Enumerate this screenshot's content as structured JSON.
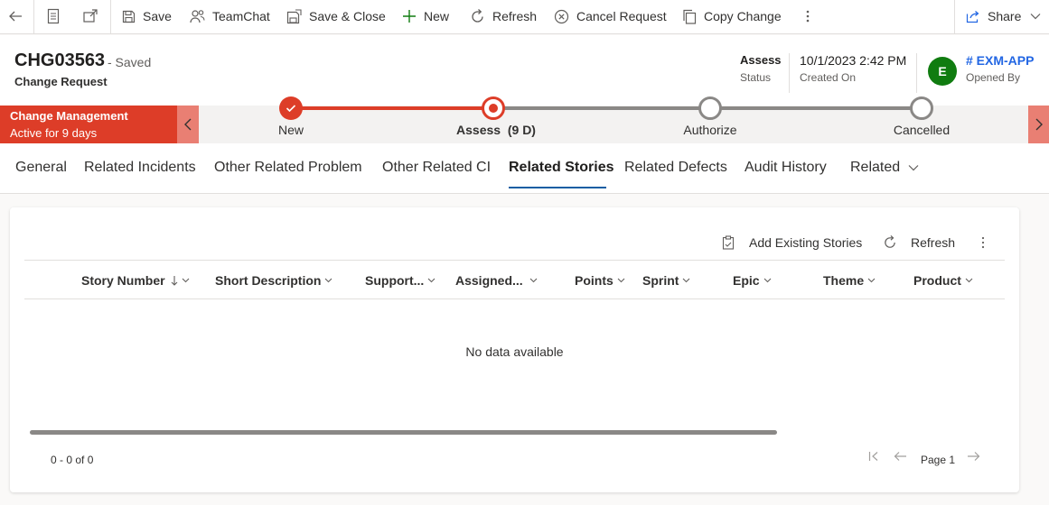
{
  "command_bar": {
    "back_icon": "back-arrow-icon",
    "form_icon": "form-icon",
    "popout_icon": "popout-icon",
    "save": "Save",
    "teamchat": "TeamChat",
    "save_close": "Save & Close",
    "new": "New",
    "refresh": "Refresh",
    "cancel_request": "Cancel Request",
    "copy_change": "Copy Change",
    "share": "Share"
  },
  "record": {
    "title": "CHG03563",
    "saved_state": "- Saved",
    "entity": "Change Request"
  },
  "header_fields": {
    "status_value": "Assess",
    "status_label": "Status",
    "created_value": "10/1/2023 2:42 PM",
    "created_label": "Created On",
    "avatar_initial": "E",
    "owner_value": "# EXM-APP",
    "owner_label": "Opened By"
  },
  "process": {
    "name": "Change Management",
    "duration": "Active for 9 days",
    "stages": [
      {
        "label": "New",
        "state": "completed"
      },
      {
        "label": "Assess  (9 D)",
        "state": "active"
      },
      {
        "label": "Authorize",
        "state": "pending"
      },
      {
        "label": "Cancelled",
        "state": "pending"
      }
    ]
  },
  "tabs": [
    "General",
    "Related Incidents",
    "Other Related Problem",
    "Other Related CI",
    "Related Stories",
    "Related Defects",
    "Audit History",
    "Related"
  ],
  "active_tab": "Related Stories",
  "grid": {
    "add_existing": "Add Existing Stories",
    "refresh": "Refresh",
    "columns": [
      "Story Number",
      "Short Description",
      "Support...",
      "Assigned...",
      "Points",
      "Sprint",
      "Epic",
      "Theme",
      "Product"
    ],
    "sort_column": "Story Number",
    "empty_message": "No data available",
    "record_count": "0 - 0 of 0",
    "page_label": "Page 1"
  },
  "colors": {
    "accent": "#115ea3",
    "process_active": "#dd3d28",
    "process_button": "#e97f73",
    "avatar": "#107c10",
    "link": "#2266e3"
  }
}
